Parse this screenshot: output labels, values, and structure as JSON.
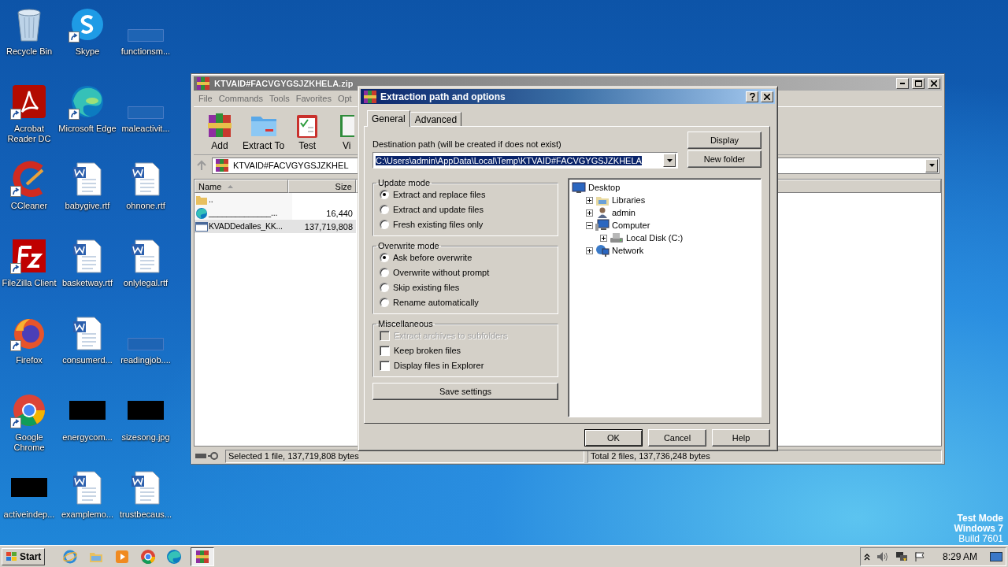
{
  "desktop": {
    "icons": [
      {
        "label": "Recycle Bin",
        "kind": "recycle",
        "shortcut": false
      },
      {
        "label": "Skype",
        "kind": "chat",
        "shortcut": true
      },
      {
        "label": "functionsm...",
        "kind": "blank",
        "shortcut": false
      },
      {
        "label": "Acrobat Reader DC",
        "kind": "pdf",
        "shortcut": true
      },
      {
        "label": "Microsoft Edge",
        "kind": "wave",
        "shortcut": true
      },
      {
        "label": "maleactivit...",
        "kind": "blank",
        "shortcut": false
      },
      {
        "label": "CCleaner",
        "kind": "cleaner",
        "shortcut": true
      },
      {
        "label": "babygive.rtf",
        "kind": "document",
        "shortcut": false
      },
      {
        "label": "ohnone.rtf",
        "kind": "document",
        "shortcut": false
      },
      {
        "label": "FileZilla Client",
        "kind": "ftp",
        "shortcut": true
      },
      {
        "label": "basketway.rtf",
        "kind": "document",
        "shortcut": false
      },
      {
        "label": "onlylegal.rtf",
        "kind": "document",
        "shortcut": false
      },
      {
        "label": "Firefox",
        "kind": "fox",
        "shortcut": true
      },
      {
        "label": "consumerd...",
        "kind": "document",
        "shortcut": false
      },
      {
        "label": "readingjob....",
        "kind": "blank",
        "shortcut": false
      },
      {
        "label": "Google Chrome",
        "kind": "ring",
        "shortcut": true
      },
      {
        "label": "energycom...",
        "kind": "black",
        "shortcut": false
      },
      {
        "label": "sizesong.jpg",
        "kind": "black",
        "shortcut": false
      },
      {
        "label": "activeindep...",
        "kind": "black",
        "shortcut": false
      },
      {
        "label": "examplemo...",
        "kind": "document",
        "shortcut": false
      },
      {
        "label": "trustbecaus...",
        "kind": "document",
        "shortcut": false
      }
    ],
    "os_notice": [
      "Test Mode",
      "Windows 7",
      "Build 7601"
    ]
  },
  "archive_window": {
    "title": "KTVAID#FACVGYGSJZKHELA.zip",
    "menu": [
      "File",
      "Commands",
      "Tools",
      "Favorites",
      "Opt"
    ],
    "toolbar": [
      {
        "label": "Add",
        "kind": "add"
      },
      {
        "label": "Extract To",
        "kind": "extract"
      },
      {
        "label": "Test",
        "kind": "test"
      },
      {
        "label": "Vi",
        "kind": "view"
      }
    ],
    "address": "KTVAID#FACVGYGSJZKHEL",
    "columns": [
      "Name",
      "Size"
    ],
    "rows": [
      {
        "name": "..",
        "kind": "folder",
        "selected": false
      },
      {
        "name": "______________...",
        "size": "16,440",
        "kind": "wave",
        "selected": false
      },
      {
        "name": "KVADDedalles_KK...",
        "size": "137,719,808",
        "kind": "file",
        "selected": true
      }
    ],
    "status": [
      "Selected 1 file, 137,719,808 bytes",
      "Total 2 files, 137,736,248 bytes"
    ]
  },
  "dialog": {
    "title": "Extraction path and options",
    "tabs": [
      {
        "label": "General",
        "selected": true
      },
      {
        "label": "Advanced",
        "selected": false
      }
    ],
    "destination_label": "Destination path (will be created if does not exist)",
    "destination_path": "C:\\Users\\admin\\AppData\\Local\\Temp\\KTVAID#FACVGYGSJZKHELA",
    "side_buttons": [
      "Display",
      "New folder"
    ],
    "groups": [
      {
        "title": "Update mode",
        "kind": "radio",
        "options": [
          {
            "label": "Extract and replace files",
            "selected": true
          },
          {
            "label": "Extract and update files",
            "selected": false
          },
          {
            "label": "Fresh existing files only",
            "selected": false
          }
        ]
      },
      {
        "title": "Overwrite mode",
        "kind": "radio",
        "options": [
          {
            "label": "Ask before overwrite",
            "selected": true
          },
          {
            "label": "Overwrite without prompt",
            "selected": false
          },
          {
            "label": "Skip existing files",
            "selected": false
          },
          {
            "label": "Rename automatically",
            "selected": false
          }
        ]
      },
      {
        "title": "Miscellaneous",
        "kind": "checkbox",
        "options": [
          {
            "label": "Extract archives to subfolders",
            "checked": false,
            "disabled": true
          },
          {
            "label": "Keep broken files",
            "checked": false,
            "disabled": false
          },
          {
            "label": "Display files in Explorer",
            "checked": false,
            "disabled": false
          }
        ]
      }
    ],
    "save_button": "Save settings",
    "tree": {
      "label": "Desktop",
      "kind": "desktop",
      "children": [
        {
          "label": "Libraries",
          "kind": "libraries",
          "expanded": false
        },
        {
          "label": "admin",
          "kind": "user",
          "expanded": false
        },
        {
          "label": "Computer",
          "kind": "computer",
          "expanded": true,
          "children": [
            {
              "label": "Local Disk (C:)",
              "kind": "disk",
              "expanded": false
            }
          ]
        },
        {
          "label": "Network",
          "kind": "network",
          "expanded": false
        }
      ]
    },
    "buttons": [
      {
        "label": "OK",
        "default": true
      },
      {
        "label": "Cancel",
        "default": false
      },
      {
        "label": "Help",
        "default": false
      }
    ]
  },
  "taskbar": {
    "start": "Start",
    "apps": [
      {
        "kind": "ie",
        "active": false
      },
      {
        "kind": "folder",
        "active": false
      },
      {
        "kind": "media",
        "active": false
      },
      {
        "kind": "ring",
        "active": false
      },
      {
        "kind": "wave",
        "active": false
      },
      {
        "kind": "archive",
        "active": true
      }
    ],
    "clock": "8:29 AM"
  }
}
